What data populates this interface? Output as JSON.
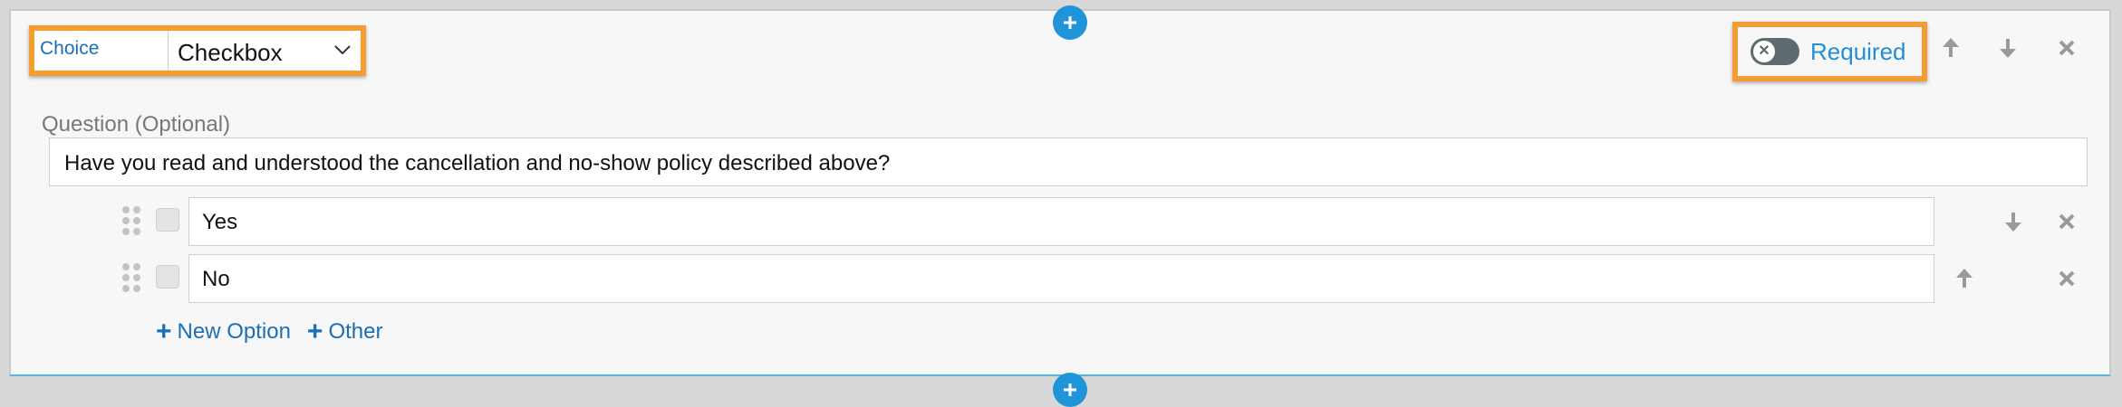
{
  "header": {
    "type_label": "Choice",
    "type_value": "Checkbox",
    "required_label": "Required",
    "required_on": false
  },
  "question": {
    "label": "Question (Optional)",
    "value": "Have you read and understood the cancellation and no-show policy described above?"
  },
  "options": [
    {
      "value": "Yes"
    },
    {
      "value": "No"
    }
  ],
  "actions": {
    "new_option": "New Option",
    "other": "Other"
  },
  "colors": {
    "accent": "#1f95d8",
    "highlight": "#f39d33",
    "link": "#1b6fb5"
  },
  "icons": {
    "add_block": "plus-icon",
    "move_up": "arrow-up-icon",
    "move_down": "arrow-down-icon",
    "delete": "close-icon",
    "drag": "drag-handle-icon",
    "dropdown": "chevron-down-icon"
  }
}
